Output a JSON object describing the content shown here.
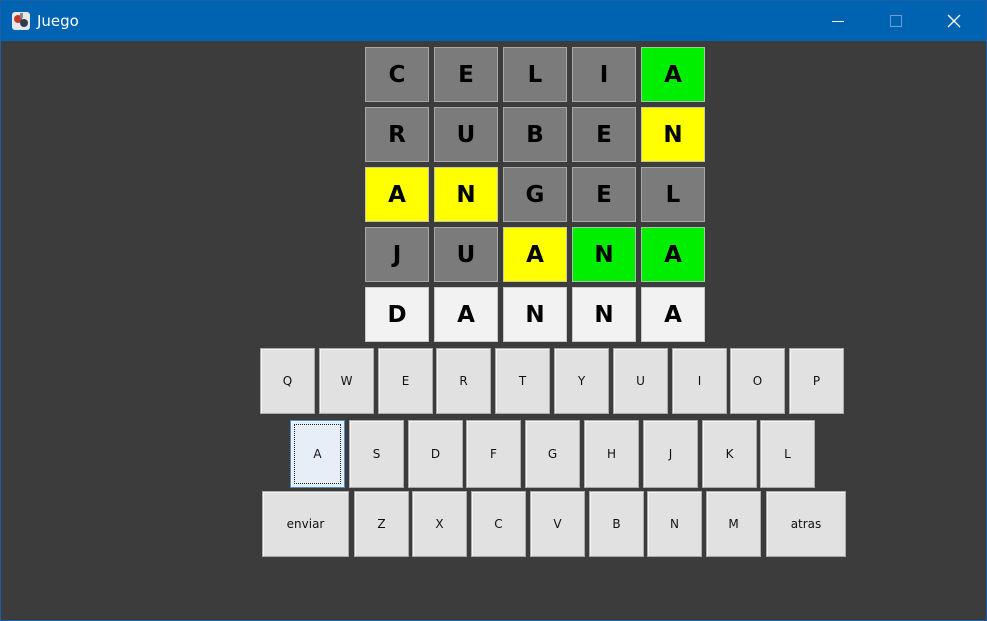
{
  "window": {
    "title": "Juego",
    "colors": {
      "titlebar": "#0063b1",
      "background": "#3c3c3c"
    }
  },
  "board": {
    "rows": [
      [
        {
          "letter": "C",
          "state": "gray"
        },
        {
          "letter": "E",
          "state": "gray"
        },
        {
          "letter": "L",
          "state": "gray"
        },
        {
          "letter": "I",
          "state": "gray"
        },
        {
          "letter": "A",
          "state": "green"
        }
      ],
      [
        {
          "letter": "R",
          "state": "gray"
        },
        {
          "letter": "U",
          "state": "gray"
        },
        {
          "letter": "B",
          "state": "gray"
        },
        {
          "letter": "E",
          "state": "gray"
        },
        {
          "letter": "N",
          "state": "yellow"
        }
      ],
      [
        {
          "letter": "A",
          "state": "yellow"
        },
        {
          "letter": "N",
          "state": "yellow"
        },
        {
          "letter": "G",
          "state": "gray"
        },
        {
          "letter": "E",
          "state": "gray"
        },
        {
          "letter": "L",
          "state": "gray"
        }
      ],
      [
        {
          "letter": "J",
          "state": "gray"
        },
        {
          "letter": "U",
          "state": "gray"
        },
        {
          "letter": "A",
          "state": "yellow"
        },
        {
          "letter": "N",
          "state": "green"
        },
        {
          "letter": "A",
          "state": "green"
        }
      ],
      [
        {
          "letter": "D",
          "state": "white"
        },
        {
          "letter": "A",
          "state": "white"
        },
        {
          "letter": "N",
          "state": "white"
        },
        {
          "letter": "N",
          "state": "white"
        },
        {
          "letter": "A",
          "state": "white"
        }
      ]
    ],
    "colors": {
      "gray": "#7b7b7b",
      "yellow": "#ffff00",
      "green": "#00ee00",
      "white": "#f2f2f2"
    }
  },
  "keyboard": {
    "rows": [
      [
        {
          "label": "Q"
        },
        {
          "label": "W"
        },
        {
          "label": "E"
        },
        {
          "label": "R"
        },
        {
          "label": "T"
        },
        {
          "label": "Y"
        },
        {
          "label": "U"
        },
        {
          "label": "I"
        },
        {
          "label": "O"
        },
        {
          "label": "P"
        }
      ],
      [
        {
          "label": "A",
          "focused": true
        },
        {
          "label": "S"
        },
        {
          "label": "D"
        },
        {
          "label": "F"
        },
        {
          "label": "G"
        },
        {
          "label": "H"
        },
        {
          "label": "J"
        },
        {
          "label": "K"
        },
        {
          "label": "L"
        }
      ],
      [
        {
          "label": "enviar"
        },
        {
          "label": "Z"
        },
        {
          "label": "X"
        },
        {
          "label": "C"
        },
        {
          "label": "V"
        },
        {
          "label": "B"
        },
        {
          "label": "N"
        },
        {
          "label": "M"
        },
        {
          "label": "atras"
        }
      ]
    ]
  }
}
